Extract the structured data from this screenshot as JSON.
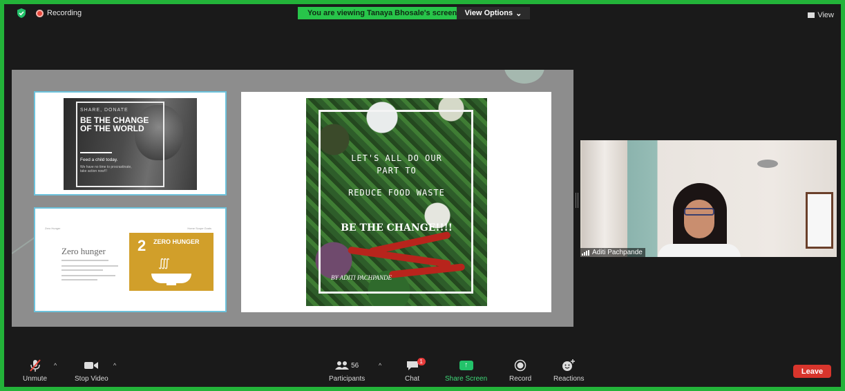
{
  "topbar": {
    "recording_label": "Recording",
    "viewing_banner": "You are viewing Tanaya Bhosale's screen",
    "view_options_label": "View Options",
    "view_label": "View"
  },
  "shared_screen": {
    "thumb1": {
      "small": "SHARE, DONATE",
      "title": "BE THE CHANGE OF THE WORLD",
      "subtitle": "Feed a child today.",
      "tiny": "We have no time to procrastinate, take action now!!!"
    },
    "thumb2": {
      "header_left": "Zero Hunger",
      "header_right": "Home  Scope  Goals",
      "title": "Zero hunger",
      "sdg_number": "2",
      "sdg_word": "ZERO HUNGER",
      "steam": "∭"
    },
    "main_poster": {
      "line1": "LET'S ALL DO OUR",
      "line2": "PART TO",
      "line3": "REDUCE FOOD WASTE",
      "headline": "BE THE CHANGE!!!!",
      "byline": "BY ADITI PACHPANDE"
    }
  },
  "participant_video": {
    "name": "Aditi Pachpande"
  },
  "toolbar": {
    "unmute": "Unmute",
    "stop_video": "Stop Video",
    "participants": "Participants",
    "participants_count": "56",
    "chat": "Chat",
    "chat_badge": "1",
    "share_screen": "Share Screen",
    "record": "Record",
    "reactions": "Reactions",
    "leave": "Leave"
  },
  "colors": {
    "border": "#23b339",
    "banner": "#28c54a",
    "leave": "#d8352c",
    "share_screen": "#23c26a"
  }
}
